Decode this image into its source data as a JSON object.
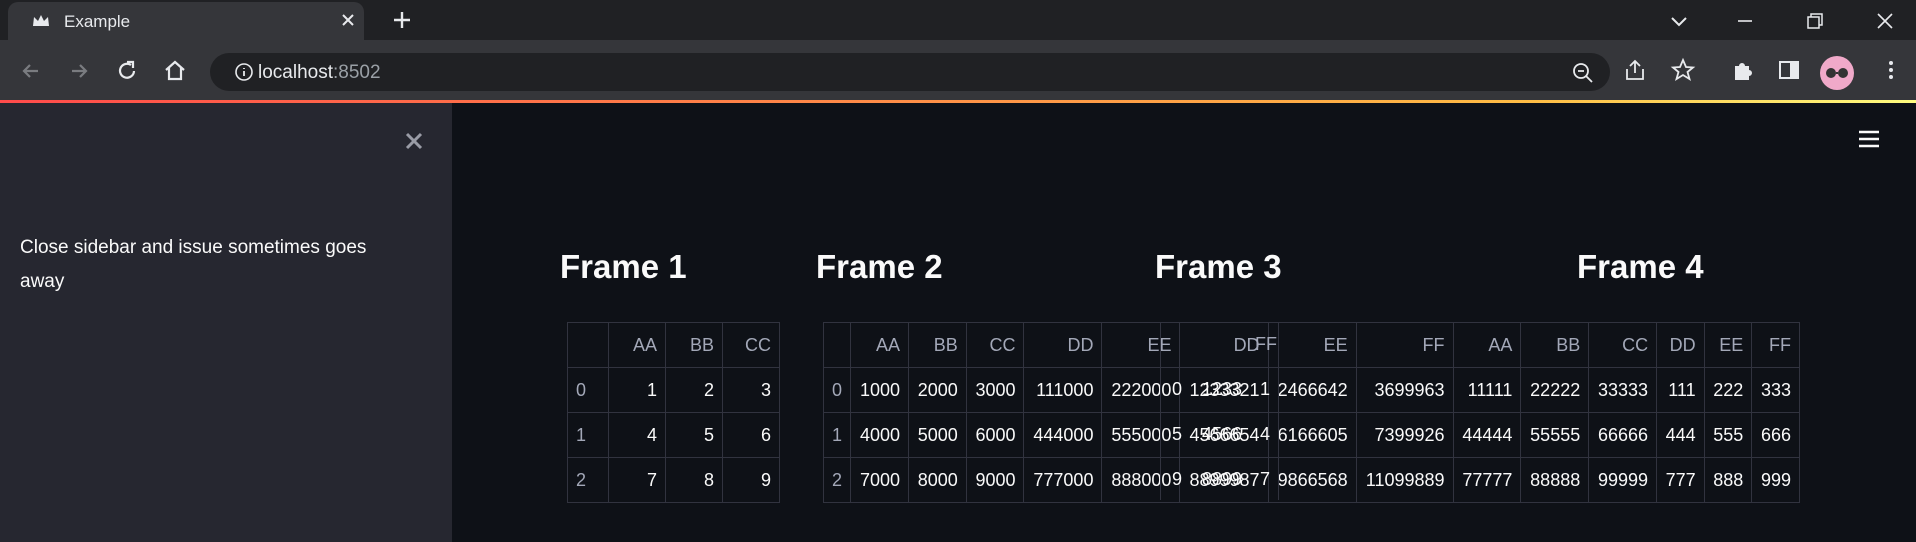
{
  "browser": {
    "tab_title": "Example",
    "url_host": "localhost",
    "url_port": ":8502",
    "accent_gradient": [
      "#ff4b4b",
      "#ffbd45",
      "#fffd80"
    ]
  },
  "sidebar": {
    "note": "Close sidebar and issue sometimes goes away"
  },
  "frames": [
    {
      "title": "Frame 1",
      "columns": [
        "AA",
        "BB",
        "CC"
      ],
      "rows": [
        {
          "index": "0",
          "values": [
            "1",
            "2",
            "3"
          ]
        },
        {
          "index": "1",
          "values": [
            "4",
            "5",
            "6"
          ]
        },
        {
          "index": "2",
          "values": [
            "7",
            "8",
            "9"
          ]
        }
      ]
    },
    {
      "title": "Frame 2",
      "columns": [
        "AA",
        "BB",
        "CC",
        "DD",
        "EE",
        "DD",
        "EE",
        "FF",
        "AA",
        "BB",
        "CC",
        "DD",
        "EE",
        "FF"
      ],
      "rows": [
        {
          "index": "0",
          "values": [
            "1000",
            "2000",
            "3000",
            "111000",
            "222000",
            "1233321",
            "2466642",
            "3699963",
            "11111",
            "22222",
            "33333",
            "111",
            "222",
            "333"
          ]
        },
        {
          "index": "1",
          "values": [
            "4000",
            "5000",
            "6000",
            "444000",
            "555000",
            "4566654",
            "6166605",
            "7399926",
            "44444",
            "55555",
            "66666",
            "444",
            "555",
            "666"
          ]
        },
        {
          "index": "2",
          "values": [
            "7000",
            "8000",
            "9000",
            "777000",
            "888000",
            "8899987",
            "9866568",
            "11099889",
            "77777",
            "88888",
            "99999",
            "777",
            "888",
            "999"
          ]
        }
      ]
    },
    {
      "title": "Frame 3"
    },
    {
      "title": "Frame 4"
    }
  ],
  "overlay_ghosts": {
    "header_ff": "FF",
    "r0": [
      "1233",
      "0",
      "1"
    ],
    "r1": [
      "4566",
      "5",
      "4"
    ],
    "r2": [
      "8899",
      "9",
      "7"
    ]
  }
}
